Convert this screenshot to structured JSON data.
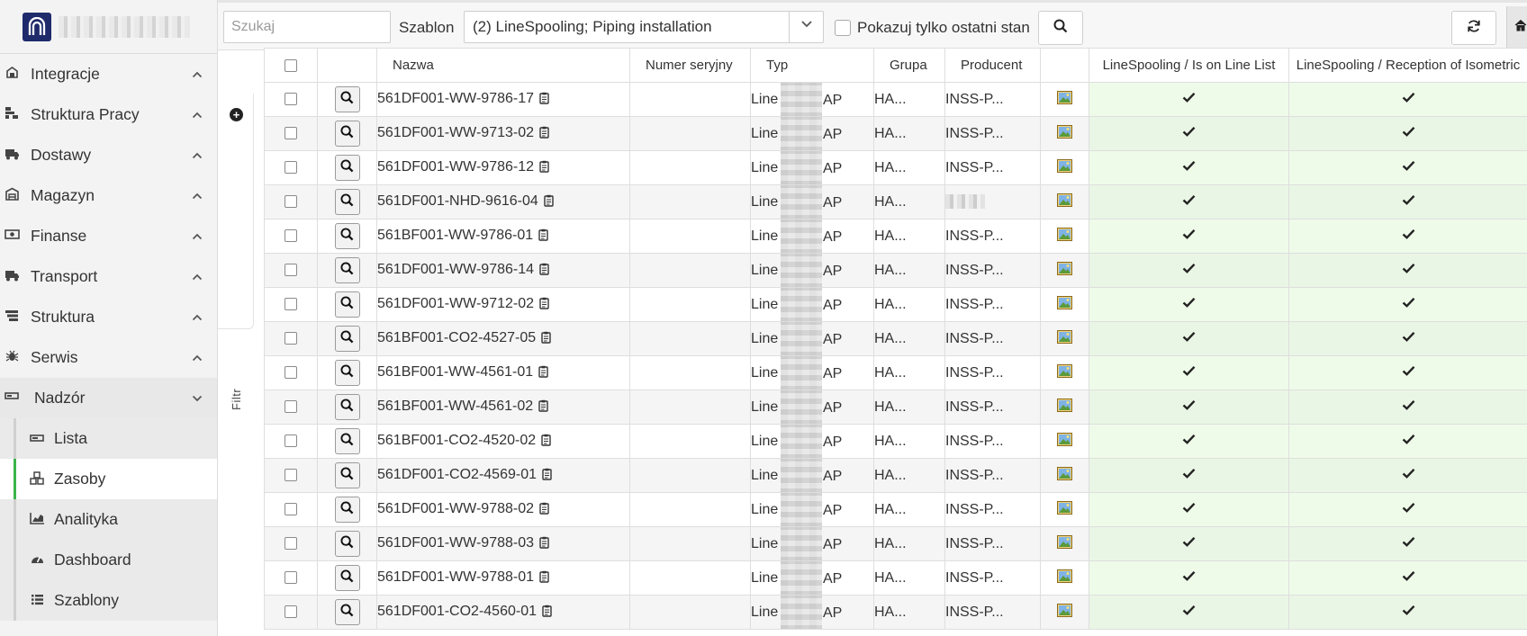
{
  "sidebar": {
    "items": [
      {
        "label": "Integracje",
        "icon": "integrations-icon"
      },
      {
        "label": "Struktura Pracy",
        "icon": "work-structure-icon"
      },
      {
        "label": "Dostawy",
        "icon": "truck-icon"
      },
      {
        "label": "Magazyn",
        "icon": "warehouse-icon"
      },
      {
        "label": "Finanse",
        "icon": "money-icon"
      },
      {
        "label": "Transport",
        "icon": "truck-icon"
      },
      {
        "label": "Struktura",
        "icon": "layers-icon"
      },
      {
        "label": "Serwis",
        "icon": "bug-icon"
      },
      {
        "label": "Nadzór",
        "icon": "monitor-icon"
      }
    ],
    "subitems": [
      {
        "label": "Lista",
        "icon": "list-minus-icon"
      },
      {
        "label": "Zasoby",
        "icon": "cubes-icon"
      },
      {
        "label": "Analityka",
        "icon": "area-chart-icon"
      },
      {
        "label": "Dashboard",
        "icon": "gauge-icon"
      },
      {
        "label": "Szablony",
        "icon": "list-icon"
      }
    ],
    "active_subitem": "Zasoby",
    "accent_color": "#3cb54a"
  },
  "filter": {
    "label": "Filtr"
  },
  "toolbar": {
    "search_placeholder": "Szukaj",
    "template_label": "Szablon",
    "template_value": "(2) LineSpooling; Piping installation",
    "only_last_state_label": "Pokazuj tylko ostatni stan"
  },
  "table": {
    "columns": {
      "name": "Nazwa",
      "serial": "Numer seryjny",
      "type": "Typ",
      "group": "Grupa",
      "producer": "Producent",
      "line_list": "LineSpooling / Is on Line List",
      "isometric": "LineSpooling / Reception of Isometric"
    },
    "rows": [
      {
        "name": "561DF001-WW-9786-17",
        "serial": "",
        "type_start": "Line",
        "type_end": "AP",
        "group": "HA...",
        "producer": "INSS-P...",
        "line_list": "✔",
        "isometric": "✔"
      },
      {
        "name": "561DF001-WW-9713-02",
        "serial": "",
        "type_start": "Line",
        "type_end": "AP",
        "group": "HA...",
        "producer": "INSS-P...",
        "line_list": "✔",
        "isometric": "✔"
      },
      {
        "name": "561DF001-WW-9786-12",
        "serial": "",
        "type_start": "Line",
        "type_end": "AP",
        "group": "HA...",
        "producer": "INSS-P...",
        "line_list": "✔",
        "isometric": "✔"
      },
      {
        "name": "561DF001-NHD-9616-04",
        "serial": "",
        "type_start": "Line",
        "type_end": "AP",
        "group": "HA...",
        "producer": "",
        "line_list": "✔",
        "isometric": "✔"
      },
      {
        "name": "561BF001-WW-9786-01",
        "serial": "",
        "type_start": "Line",
        "type_end": "AP",
        "group": "HA...",
        "producer": "INSS-P...",
        "line_list": "✔",
        "isometric": "✔"
      },
      {
        "name": "561DF001-WW-9786-14",
        "serial": "",
        "type_start": "Line",
        "type_end": "AP",
        "group": "HA...",
        "producer": "INSS-P...",
        "line_list": "✔",
        "isometric": "✔"
      },
      {
        "name": "561DF001-WW-9712-02",
        "serial": "",
        "type_start": "Line",
        "type_end": "AP",
        "group": "HA...",
        "producer": "INSS-P...",
        "line_list": "✔",
        "isometric": "✔"
      },
      {
        "name": "561BF001-CO2-4527-05",
        "serial": "",
        "type_start": "Line",
        "type_end": "AP",
        "group": "HA...",
        "producer": "INSS-P...",
        "line_list": "✔",
        "isometric": "✔"
      },
      {
        "name": "561BF001-WW-4561-01",
        "serial": "",
        "type_start": "Line",
        "type_end": "AP",
        "group": "HA...",
        "producer": "INSS-P...",
        "line_list": "✔",
        "isometric": "✔"
      },
      {
        "name": "561BF001-WW-4561-02",
        "serial": "",
        "type_start": "Line",
        "type_end": "AP",
        "group": "HA...",
        "producer": "INSS-P...",
        "line_list": "✔",
        "isometric": "✔"
      },
      {
        "name": "561BF001-CO2-4520-02",
        "serial": "",
        "type_start": "Line",
        "type_end": "AP",
        "group": "HA...",
        "producer": "INSS-P...",
        "line_list": "✔",
        "isometric": "✔"
      },
      {
        "name": "561DF001-CO2-4569-01",
        "serial": "",
        "type_start": "Line",
        "type_end": "AP",
        "group": "HA...",
        "producer": "INSS-P...",
        "line_list": "✔",
        "isometric": "✔"
      },
      {
        "name": "561DF001-WW-9788-02",
        "serial": "",
        "type_start": "Line",
        "type_end": "AP",
        "group": "HA...",
        "producer": "INSS-P...",
        "line_list": "✔",
        "isometric": "✔"
      },
      {
        "name": "561DF001-WW-9788-03",
        "serial": "",
        "type_start": "Line",
        "type_end": "AP",
        "group": "HA...",
        "producer": "INSS-P...",
        "line_list": "✔",
        "isometric": "✔"
      },
      {
        "name": "561DF001-WW-9788-01",
        "serial": "",
        "type_start": "Line",
        "type_end": "AP",
        "group": "HA...",
        "producer": "INSS-P...",
        "line_list": "✔",
        "isometric": "✔"
      },
      {
        "name": "561DF001-CO2-4560-01",
        "serial": "",
        "type_start": "Line",
        "type_end": "AP",
        "group": "HA...",
        "producer": "INSS-P...",
        "line_list": "✔",
        "isometric": "✔"
      }
    ],
    "bool_cell_color": "#eefbe9"
  }
}
